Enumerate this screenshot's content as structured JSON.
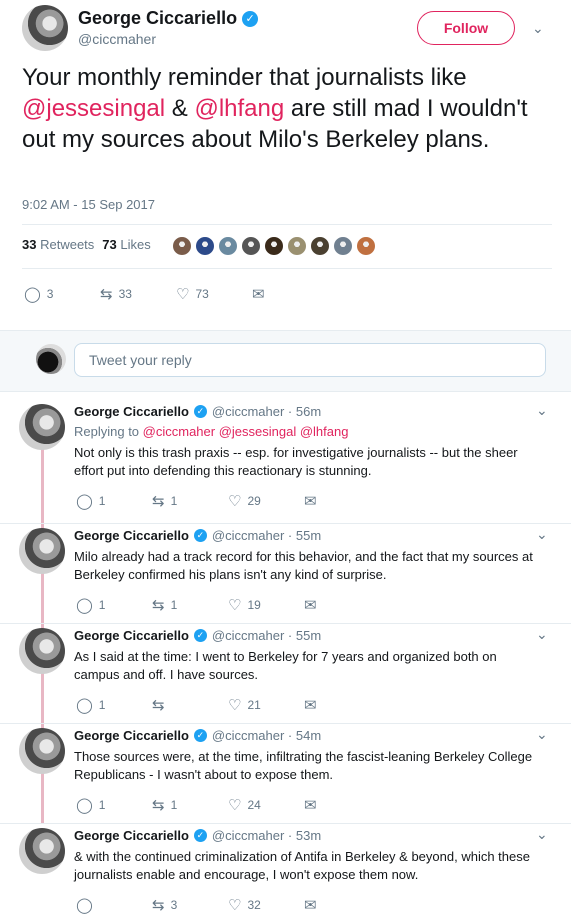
{
  "main": {
    "name": "George Ciccariello",
    "handle": "@ciccmaher",
    "follow_label": "Follow",
    "text_1": "Your monthly reminder that journalists like ",
    "mention_1": "@jessesingal",
    "text_2": " & ",
    "mention_2": "@lhfang",
    "text_3": " are still mad I wouldn't out my sources about Milo's Berkeley plans.",
    "timestamp": "9:02 AM - 15 Sep 2017",
    "retweets_count": "33",
    "retweets_label": "Retweets",
    "likes_count": "73",
    "likes_label": "Likes",
    "reply_count": "3",
    "retweet_action_count": "33",
    "like_action_count": "73",
    "liker_colors": [
      "#7a5c4a",
      "#2c4a8a",
      "#6a8aa0",
      "#555555",
      "#3a2a1a",
      "#9a9070",
      "#4a4030",
      "#708090",
      "#c07040"
    ]
  },
  "reply_bar": {
    "placeholder": "Tweet your reply"
  },
  "tweets": [
    {
      "name": "George Ciccariello",
      "handle": "@ciccmaher · 56m",
      "replying_label": "Replying to ",
      "replying_to": "@ciccmaher @jessesingal @lhfang",
      "body": "Not only is this trash praxis -- esp. for investigative journalists -- but the sheer effort put into defending this reactionary is stunning.",
      "replies": "1",
      "retweets": "1",
      "likes": "29"
    },
    {
      "name": "George Ciccariello",
      "handle": "@ciccmaher · 55m",
      "body": "Milo already had a track record for this behavior, and the fact that my sources at Berkeley confirmed his plans isn't any kind of surprise.",
      "replies": "1",
      "retweets": "1",
      "likes": "19"
    },
    {
      "name": "George Ciccariello",
      "handle": "@ciccmaher · 55m",
      "body": "As I said at the time: I went to Berkeley for 7 years and organized both on campus and off. I have sources.",
      "replies": "1",
      "retweets": "",
      "likes": "21"
    },
    {
      "name": "George Ciccariello",
      "handle": "@ciccmaher · 54m",
      "body": "Those sources were, at the time, infiltrating the fascist-leaning Berkeley College Republicans - I wasn't about to expose them.",
      "replies": "1",
      "retweets": "1",
      "likes": "24"
    },
    {
      "name": "George Ciccariello",
      "handle": "@ciccmaher · 53m",
      "body": "& with the continued criminalization of Antifa in Berkeley & beyond, which these journalists enable and encourage, I won't expose them now.",
      "replies": "",
      "retweets": "3",
      "likes": "32"
    }
  ],
  "icons": {
    "verified": "✓",
    "chevron": "⌄",
    "reply": "◯",
    "retweet": "⇆",
    "like": "♡",
    "dm": "✉"
  },
  "colors": {
    "accent": "#e0245e",
    "verified": "#1da1f2",
    "muted": "#657786",
    "thread_line": "#e8b7c4"
  }
}
